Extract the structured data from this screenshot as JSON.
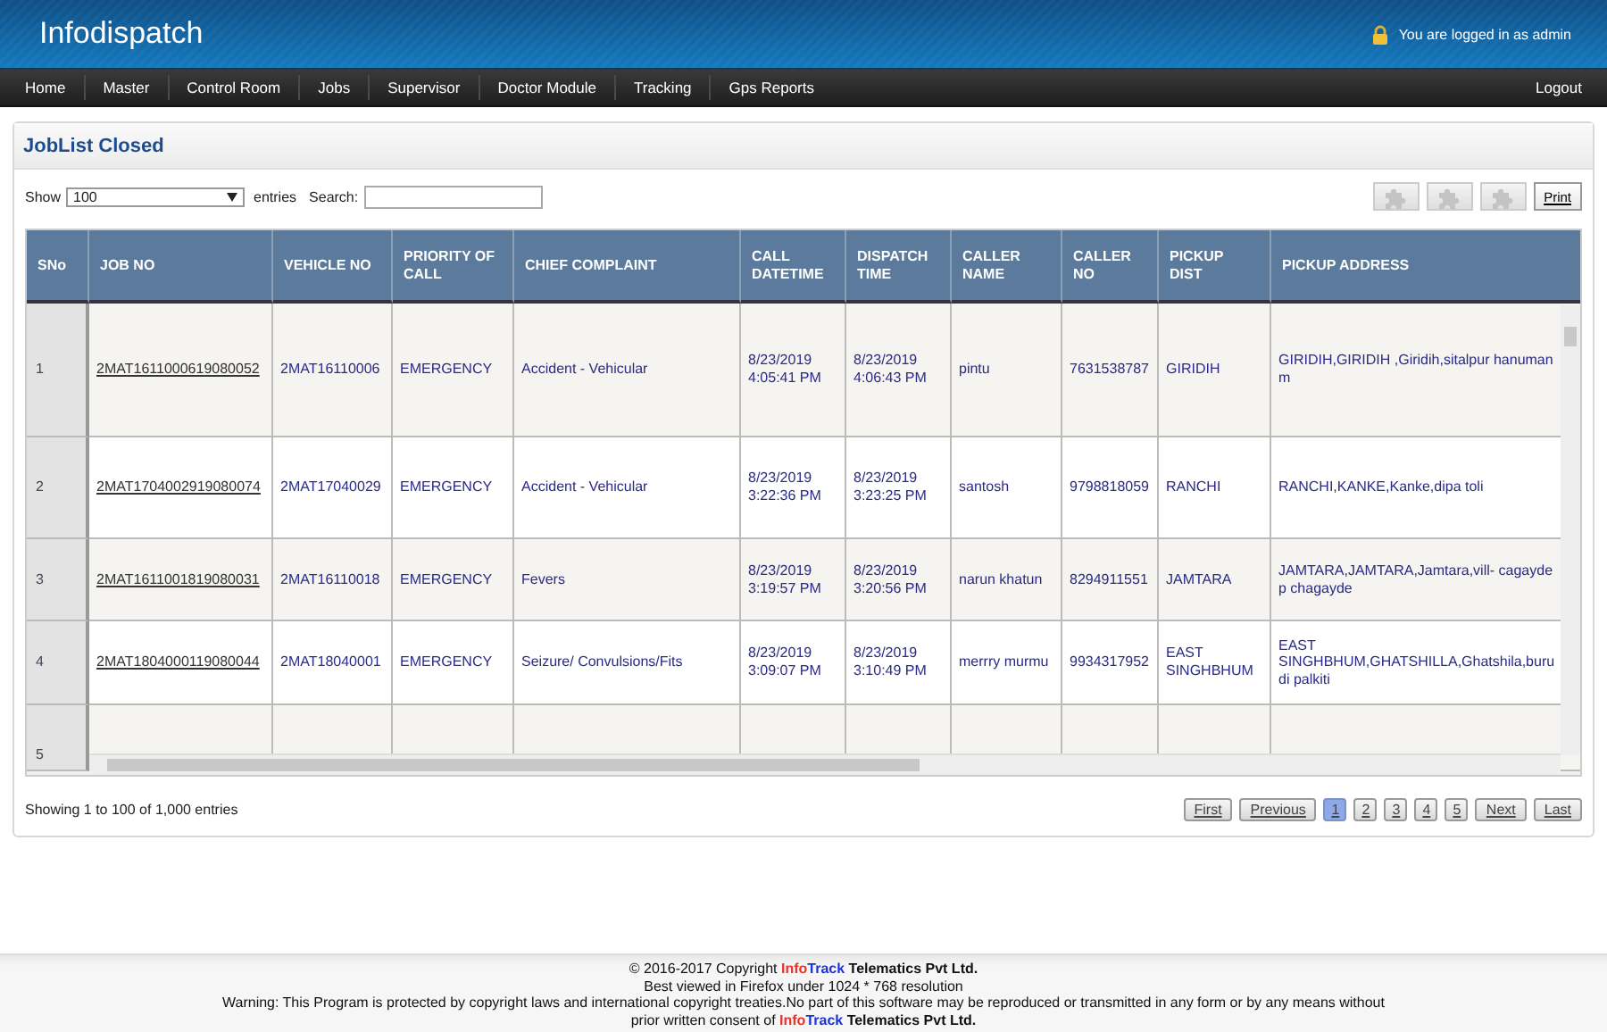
{
  "header": {
    "app_title": "Infodispatch",
    "login_text": "You are logged in as admin"
  },
  "nav": {
    "items": [
      {
        "label": "Home"
      },
      {
        "label": "Master"
      },
      {
        "label": "Control Room"
      },
      {
        "label": "Jobs"
      },
      {
        "label": "Supervisor"
      },
      {
        "label": "Doctor Module"
      },
      {
        "label": "Tracking"
      },
      {
        "label": "Gps Reports"
      }
    ],
    "logout": "Logout"
  },
  "panel": {
    "title": "JobList Closed",
    "length_control": {
      "prefix": "Show",
      "value": "100",
      "suffix": "entries"
    },
    "search": {
      "label": "Search:"
    },
    "toolbar": {
      "icon_buttons": [
        {
          "disabled": true
        },
        {
          "disabled": true
        },
        {
          "disabled": true
        }
      ],
      "print": "Print"
    },
    "table": {
      "columns": [
        "SNo",
        "JOB NO",
        "VEHICLE NO",
        "PRIORITY OF CALL",
        "CHIEF COMPLAINT",
        "CALL DATETIME",
        "DISPATCH TIME",
        "CALLER NAME",
        "CALLER NO",
        "PICKUP DIST",
        "PICKUP ADDRESS"
      ],
      "rows": [
        {
          "sno": "1",
          "job_no": "2MAT1611000619080052",
          "vehicle_no": "2MAT16110006",
          "priority": "EMERGENCY",
          "complaint": "Accident - Vehicular",
          "call_datetime": "8/23/2019 4:05:41 PM",
          "dispatch_time": "8/23/2019 4:06:43 PM",
          "caller_name": "pintu",
          "caller_no": "7631538787",
          "pickup_dist": "GIRIDIH",
          "pickup_address": "GIRIDIH,GIRIDIH ,Giridih,sitalpur hanuman m"
        },
        {
          "sno": "2",
          "job_no": "2MAT1704002919080074",
          "vehicle_no": "2MAT17040029",
          "priority": "EMERGENCY",
          "complaint": "Accident - Vehicular",
          "call_datetime": "8/23/2019 3:22:36 PM",
          "dispatch_time": "8/23/2019 3:23:25 PM",
          "caller_name": "santosh",
          "caller_no": "9798818059",
          "pickup_dist": "RANCHI",
          "pickup_address": "RANCHI,KANKE,Kanke,dipa toli"
        },
        {
          "sno": "3",
          "job_no": "2MAT1611001819080031",
          "vehicle_no": "2MAT16110018",
          "priority": "EMERGENCY",
          "complaint": "Fevers",
          "call_datetime": "8/23/2019 3:19:57 PM",
          "dispatch_time": "8/23/2019 3:20:56 PM",
          "caller_name": "narun khatun",
          "caller_no": "8294911551",
          "pickup_dist": "JAMTARA",
          "pickup_address": "JAMTARA,JAMTARA,Jamtara,vill- cagayde p chagayde"
        },
        {
          "sno": "4",
          "job_no": "2MAT1804000119080044",
          "vehicle_no": "2MAT18040001",
          "priority": "EMERGENCY",
          "complaint": "Seizure/ Convulsions/Fits",
          "call_datetime": "8/23/2019 3:09:07 PM",
          "dispatch_time": "8/23/2019 3:10:49 PM",
          "caller_name": "merrry murmu",
          "caller_no": "9934317952",
          "pickup_dist": "EAST SINGHBHUM",
          "pickup_address": "EAST SINGHBHUM,GHATSHILLA,Ghatshila,burudi palkiti"
        },
        {
          "sno": "5"
        }
      ]
    },
    "info": "Showing 1 to 100 of 1,000 entries",
    "pagination": [
      {
        "label": "First",
        "kind": "nav",
        "selected": false
      },
      {
        "label": "Previous",
        "kind": "nav",
        "selected": false
      },
      {
        "label": "1",
        "kind": "page",
        "selected": true
      },
      {
        "label": "2",
        "kind": "page",
        "selected": false
      },
      {
        "label": "3",
        "kind": "page",
        "selected": false
      },
      {
        "label": "4",
        "kind": "page",
        "selected": false
      },
      {
        "label": "5",
        "kind": "page",
        "selected": false
      },
      {
        "label": "Next",
        "kind": "nav",
        "selected": false
      },
      {
        "label": "Last",
        "kind": "nav",
        "selected": false
      }
    ]
  },
  "footer": {
    "lines": [
      [
        {
          "kind": "plain",
          "text": "© 2016-2017 Copyright "
        },
        {
          "kind": "brand_info",
          "text": "Info"
        },
        {
          "kind": "brand_track",
          "text": "Track"
        },
        {
          "kind": "bold",
          "text": " Telematics Pvt Ltd."
        }
      ],
      [
        {
          "kind": "plain",
          "text": "Best viewed in Firefox under 1024 * 768 resolution"
        }
      ],
      [
        {
          "kind": "plain",
          "text": "Warning: This Program is protected by copyright laws and international copyright treaties.No part of this software may be reproduced or transmitted in any form or by any means without prior written consent of "
        },
        {
          "kind": "brand_info",
          "text": "Info"
        },
        {
          "kind": "brand_track",
          "text": "Track"
        },
        {
          "kind": "bold",
          "text": " Telematics Pvt Ltd."
        }
      ]
    ]
  }
}
